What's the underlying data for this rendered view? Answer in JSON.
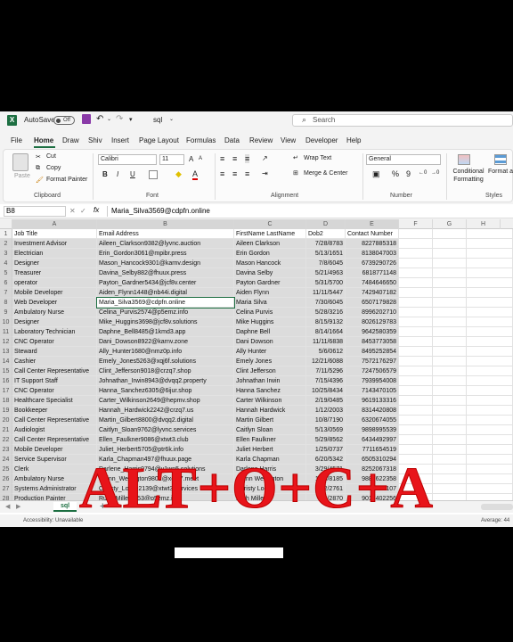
{
  "titlebar": {
    "logo": "X",
    "autosave_label": "AutoSave",
    "autosave_state": "Off",
    "filename": "sql",
    "search_placeholder": "Search"
  },
  "menu": [
    "File",
    "Home",
    "Draw",
    "Shiv",
    "Insert",
    "Page Layout",
    "Formulas",
    "Data",
    "Review",
    "View",
    "Developer",
    "Help"
  ],
  "ribbon": {
    "clipboard": {
      "paste": "Paste",
      "cut": "Cut",
      "copy": "Copy",
      "format_painter": "Format Painter",
      "label": "Clipboard"
    },
    "font": {
      "name": "Calibri",
      "size": "11",
      "label": "Font",
      "bold": "B",
      "italic": "I",
      "underline": "U"
    },
    "alignment": {
      "wrap": "Wrap Text",
      "merge": "Merge & Center",
      "label": "Alignment"
    },
    "number": {
      "format": "General",
      "label": "Number",
      "currency": "$",
      "percent": "%",
      "comma": "9"
    },
    "styles": {
      "conditional": "Conditional Formatting",
      "format_as_table": "Format as Table",
      "label": "Styles"
    }
  },
  "formula_bar": {
    "name_box": "B8",
    "fx": "fx",
    "content": "Maria_Silva3569@cdpfn.online"
  },
  "columns": [
    "A",
    "B",
    "C",
    "D",
    "E",
    "F",
    "G",
    "H"
  ],
  "rows": [
    [
      "1",
      "Job Title",
      "Email Address",
      "FirstName LastName",
      "Dob2",
      "Contact Number"
    ],
    [
      "2",
      "Investment  Advisor",
      "Aileen_Clarkson9382@lyvnc.auction",
      "Aileen Clarkson",
      "7/28/8783",
      "8227885318"
    ],
    [
      "3",
      "Electrician",
      "Erin_Gordon3061@mpibr.press",
      "Erin Gordon",
      "5/13/1651",
      "8138047003"
    ],
    [
      "4",
      "Designer",
      "Mason_Hancock9301@karnv.design",
      "Mason Hancock",
      "7/8/6045",
      "6739290726"
    ],
    [
      "5",
      "Treasurer",
      "Davina_Selby882@fhuux.press",
      "Davina Selby",
      "5/21/4963",
      "6818771148"
    ],
    [
      "6",
      "operator",
      "Payton_Gardner5434@jcf8v.center",
      "Payton Gardner",
      "5/31/5700",
      "7484646650"
    ],
    [
      "7",
      "Mobile Developer",
      "Aiden_Flynn1448@nb44i.digital",
      "Aiden Flynn",
      "11/11/5447",
      "7429407182"
    ],
    [
      "8",
      "Web Developer",
      "Maria_Silva3569@cdpfn.online",
      "Maria Silva",
      "7/30/6045",
      "6507179828"
    ],
    [
      "9",
      "Ambulatory Nurse",
      "Celina_Purvis2574@p5emz.info",
      "Celina Purvis",
      "5/28/3216",
      "8996202710"
    ],
    [
      "10",
      "Designer",
      "Mike_Huggins3698@jcf8v.solutions",
      "Mike Huggins",
      "8/15/9132",
      "8026129783"
    ],
    [
      "11",
      "Laboratory Technician",
      "Daphne_Bell8485@1kmd3.app",
      "Daphne Bell",
      "8/14/1664",
      "9642580359"
    ],
    [
      "12",
      "CNC Operator",
      "Dani_Dowson8922@karnv.zone",
      "Dani Dowson",
      "11/11/6838",
      "8453773058"
    ],
    [
      "13",
      "Steward",
      "Ally_Hunter1680@nmz0p.info",
      "Ally Hunter",
      "5/6/0612",
      "8495252854"
    ],
    [
      "14",
      "Cashier",
      "Emely_Jones5263@xqj6f.solutions",
      "Emely Jones",
      "12/21/6088",
      "7572176297"
    ],
    [
      "15",
      "Call Center Representative",
      "Clint_Jefferson9018@crzq7.shop",
      "Clint Jefferson",
      "7/11/5296",
      "7247506579"
    ],
    [
      "16",
      "IT Support Staff",
      "Johnathan_Irwin8943@dvqq2.property",
      "Johnathan Irwin",
      "7/15/4396",
      "7939954008"
    ],
    [
      "17",
      "CNC Operator",
      "Hanna_Sanchez6305@6ijur.shop",
      "Hanna Sanchez",
      "10/25/8434",
      "7143470105"
    ],
    [
      "18",
      "Healthcare Specialist",
      "Carter_Wilkinson2649@hepmv.shop",
      "Carter Wilkinson",
      "2/19/0485",
      "9619133316"
    ],
    [
      "19",
      "Bookkeeper",
      "Hannah_Hardwick2242@crzq7.us",
      "Hannah Hardwick",
      "1/12/2003",
      "8314420808"
    ],
    [
      "20",
      "Call Center Representative",
      "Martin_Gilbert8800@dvqq2.digital",
      "Martin Gilbert",
      "10/8/7190",
      "6320674055"
    ],
    [
      "21",
      "Audiologist",
      "Caitlyn_Sloan9762@lyvnc.services",
      "Caitlyn Sloan",
      "5/13/0569",
      "9898995539"
    ],
    [
      "22",
      "Call Center Representative",
      "Ellen_Faulkner9086@xtwt3.club",
      "Ellen Faulkner",
      "5/29/8562",
      "6434492997"
    ],
    [
      "23",
      "Mobile Developer",
      "Juliet_Herbert5705@ptr6k.info",
      "Juliet Herbert",
      "1/25/0737",
      "7711654519"
    ],
    [
      "24",
      "Service Supervisor",
      "Karla_Chapman497@fhuux.page",
      "Karla Chapman",
      "6/20/5342",
      "6505310294"
    ],
    [
      "25",
      "Clerk",
      "Darlene_Harris9794@v1wn5.solutions",
      "Darlene Harris",
      "3/29/4571",
      "8252067318"
    ],
    [
      "26",
      "Ambulatory Nurse",
      "Quinn_Wellington9801@xq0j7.meet",
      "Quinn Wellington",
      "10/3/8185",
      "9887622358"
    ],
    [
      "27",
      "Systems Administrator",
      "Christy_Locke2139@xtwt3.services",
      "Christy Locke",
      "5/2/2761",
      "6817735107"
    ],
    [
      "28",
      "Production Painter",
      "Ruth_Miller7753@p5emz.info",
      "Ruth Miller",
      "4/9/2870",
      "9017402256"
    ]
  ],
  "sheet_tab": "sql",
  "status": {
    "accessibility": "Accessibility: Unavailable",
    "average": "Average: 44"
  },
  "overlay_text": "ALT+O+C+A",
  "colors": {
    "excel_green": "#1d6f42",
    "overlay_red": "#e8141a"
  }
}
